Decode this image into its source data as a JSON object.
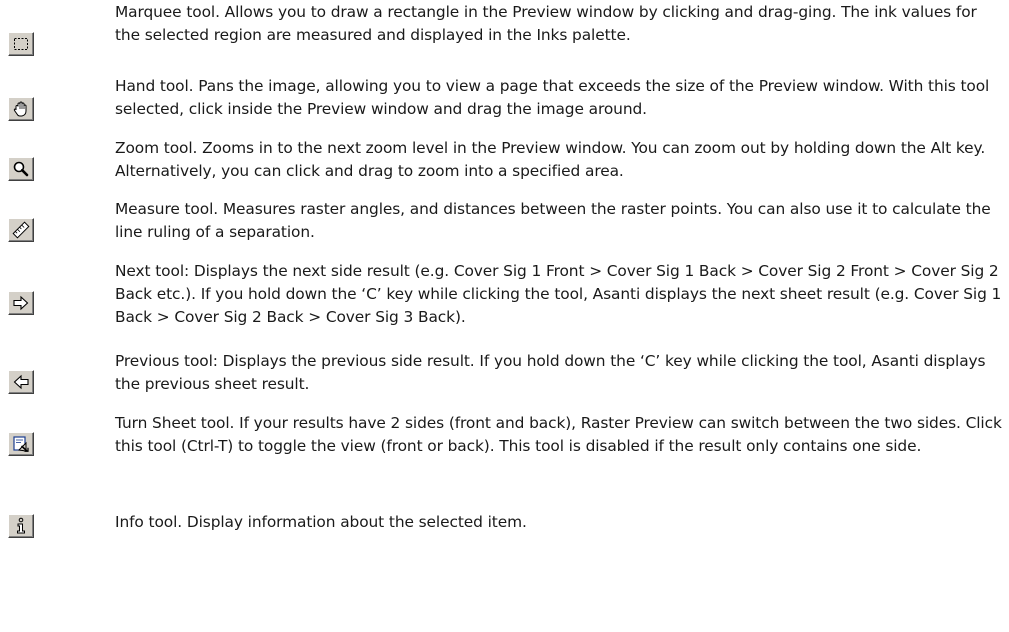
{
  "tools": [
    {
      "icon": "marquee-icon",
      "description": "Marquee tool. Allows you to draw a rectangle in the Preview window by clicking and drag-ging. The ink values for the selected region are measured and displayed in the Inks palette."
    },
    {
      "icon": "hand-icon",
      "description": "Hand tool. Pans the image, allowing you to view a page that exceeds the size of the Preview window. With this tool selected, click inside the Preview window and drag the image around."
    },
    {
      "icon": "zoom-icon",
      "description": "Zoom tool. Zooms in to the next zoom level in the Preview window. You can zoom out by holding down the Alt key. Alternatively, you can click and drag to zoom into a specified area."
    },
    {
      "icon": "measure-icon",
      "description": "Measure tool. Measures raster angles, and distances between the raster points. You can also use it to calculate the line ruling of a separation."
    },
    {
      "icon": "next-arrow-icon",
      "description": "Next tool: Displays the next side result (e.g. Cover Sig 1 Front > Cover Sig 1 Back > Cover Sig 2 Front > Cover Sig 2 Back etc.). If you hold down the ‘C’ key while clicking the tool, Asanti displays the next sheet result (e.g. Cover Sig 1 Back > Cover Sig 2 Back > Cover Sig 3 Back)."
    },
    {
      "icon": "previous-arrow-icon",
      "description": "Previous tool: Displays the previous side result. If you hold down the ‘C’ key while clicking the tool, Asanti displays the previous sheet result."
    },
    {
      "icon": "turn-sheet-icon",
      "description": "Turn Sheet tool. If your results have 2 sides (front and back), Raster Preview can switch between the two sides. Click this tool (Ctrl-T) to toggle the view (front or back). This tool is disabled if the result only contains one side."
    },
    {
      "icon": "info-icon",
      "description": "Info tool. Display information about the selected item."
    }
  ]
}
